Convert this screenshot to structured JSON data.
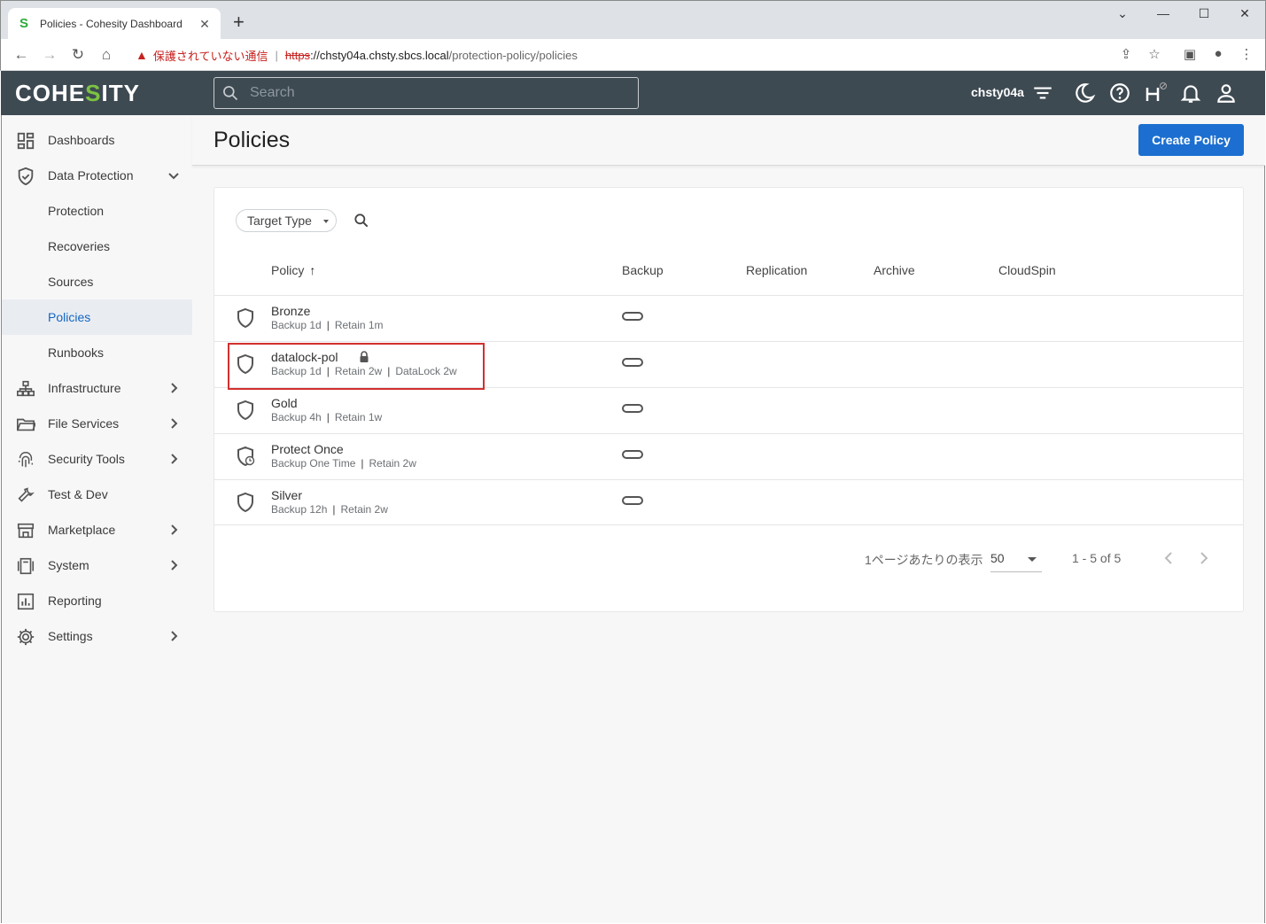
{
  "browser": {
    "tab_title": "Policies - Cohesity Dashboard",
    "tab_favicon": "S",
    "url_warning": "保護されていない通信",
    "url_scheme": "https",
    "url_host": "://chsty04a.chsty.sbcs.local",
    "url_path": "/protection-policy/policies"
  },
  "app": {
    "logo_prefix": "COHE",
    "logo_mid": "S",
    "logo_suffix": "ITY",
    "search_placeholder": "Search",
    "user": "chsty04a"
  },
  "sidebar": {
    "items": [
      {
        "label": "Dashboards",
        "icon": "dashboard-icon"
      },
      {
        "label": "Data Protection",
        "icon": "shield-check-icon",
        "expanded": true
      },
      {
        "label": "Protection"
      },
      {
        "label": "Recoveries"
      },
      {
        "label": "Sources"
      },
      {
        "label": "Policies",
        "active": true
      },
      {
        "label": "Runbooks"
      },
      {
        "label": "Infrastructure",
        "icon": "infrastructure-icon"
      },
      {
        "label": "File Services",
        "icon": "folder-icon"
      },
      {
        "label": "Security Tools",
        "icon": "fingerprint-icon"
      },
      {
        "label": "Test & Dev",
        "icon": "wrench-icon"
      },
      {
        "label": "Marketplace",
        "icon": "store-icon"
      },
      {
        "label": "System",
        "icon": "system-icon"
      },
      {
        "label": "Reporting",
        "icon": "chart-icon"
      },
      {
        "label": "Settings",
        "icon": "gear-icon"
      }
    ]
  },
  "page": {
    "title": "Policies",
    "create_button": "Create Policy",
    "filter_label": "Target Type"
  },
  "table": {
    "columns": [
      "Policy",
      "Backup",
      "Replication",
      "Archive",
      "CloudSpin"
    ],
    "sort_arrow": "↑",
    "rows": [
      {
        "name": "Bronze",
        "details": [
          "Backup 1d",
          "Retain 1m"
        ],
        "icon": "shield-icon"
      },
      {
        "name": "datalock-pol",
        "details": [
          "Backup 1d",
          "Retain 2w",
          "DataLock 2w"
        ],
        "icon": "shield-icon",
        "locked": true
      },
      {
        "name": "Gold",
        "details": [
          "Backup 4h",
          "Retain 1w"
        ],
        "icon": "shield-icon"
      },
      {
        "name": "Protect Once",
        "details": [
          "Backup One Time",
          "Retain 2w"
        ],
        "icon": "shield-clock-icon"
      },
      {
        "name": "Silver",
        "details": [
          "Backup 12h",
          "Retain 2w"
        ],
        "icon": "shield-icon"
      }
    ]
  },
  "pagination": {
    "per_page_label": "1ページあたりの表示",
    "per_page_value": "50",
    "range": "1 - 5 of 5"
  }
}
